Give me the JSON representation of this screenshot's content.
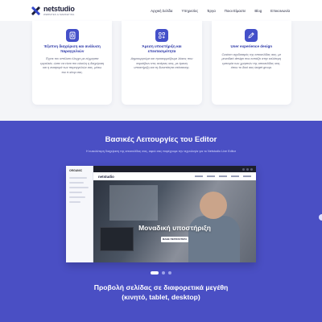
{
  "header": {
    "logo_name": "netstudio",
    "logo_tagline": "WEBSITES & MARKETING",
    "nav": [
      "Αρχική Σελίδα",
      "Υπηρεσίες",
      "Έργα",
      "Ποιοι Είμαστε",
      "Blog",
      "Επικοινωνία"
    ]
  },
  "cards": [
    {
      "icon": "document-cart-icon",
      "title": "Έξυπνη διαχείριση και ανάλυση παραγγελιών",
      "text": "Έχετε τον απόλυτο έλεγχο με εύχρηστα εργαλεία, ώστε να είναι πιο εύκολη η διαχείριση και η αναφορά των παραγγελιών σας, μέσω του e-shop σας."
    },
    {
      "icon": "apps-plus-icon",
      "title": "Άμεση υποστήριξη και επεκτασιμότητα",
      "text": "Δημιουργούμε και προσαρμόζουμε λύσεις που ταιριάζουν στις ανάγκες σας, με άμεση υποστήριξη και τη δυνατότητα επέκτασης."
    },
    {
      "icon": "pen-edit-icon",
      "title": "User experience design",
      "text": "Custom σχεδιασμός της ιστοσελίδας σας, με μοναδικό design που εστιάζει στην καλύτερη εμπειρία των χρηστών της ιστοσελίδας σας, όπου το δικό σας target group."
    }
  ],
  "editor": {
    "title": "Βασικές Λειτουργίες του Editor",
    "subtitle": "Η ευκολότερη διαχείριση της ιστοσελίδας σας, αφού σας παρέχουμε την τεχνολογία για το Netstudio Live Editor",
    "screenshot": {
      "sidebar_brand": "ORGANIC",
      "mini_logo": "netstudio",
      "hero_headline": "Μοναδική υποστήριξη",
      "hero_button": "ΜΑΘΕ ΠΕΡΙΣΣΟΤΕΡΑ"
    },
    "carousel": {
      "count": 3,
      "active": 1
    },
    "responsive_title_line1": "Προβολή σελίδας σε διαφορετικά μεγέθη",
    "responsive_title_line2": "(κινητό, tablet, desktop)"
  },
  "colors": {
    "brand": "#4a4fc4",
    "icon_bg": "#4450c9",
    "card_title": "#2e39a8"
  }
}
